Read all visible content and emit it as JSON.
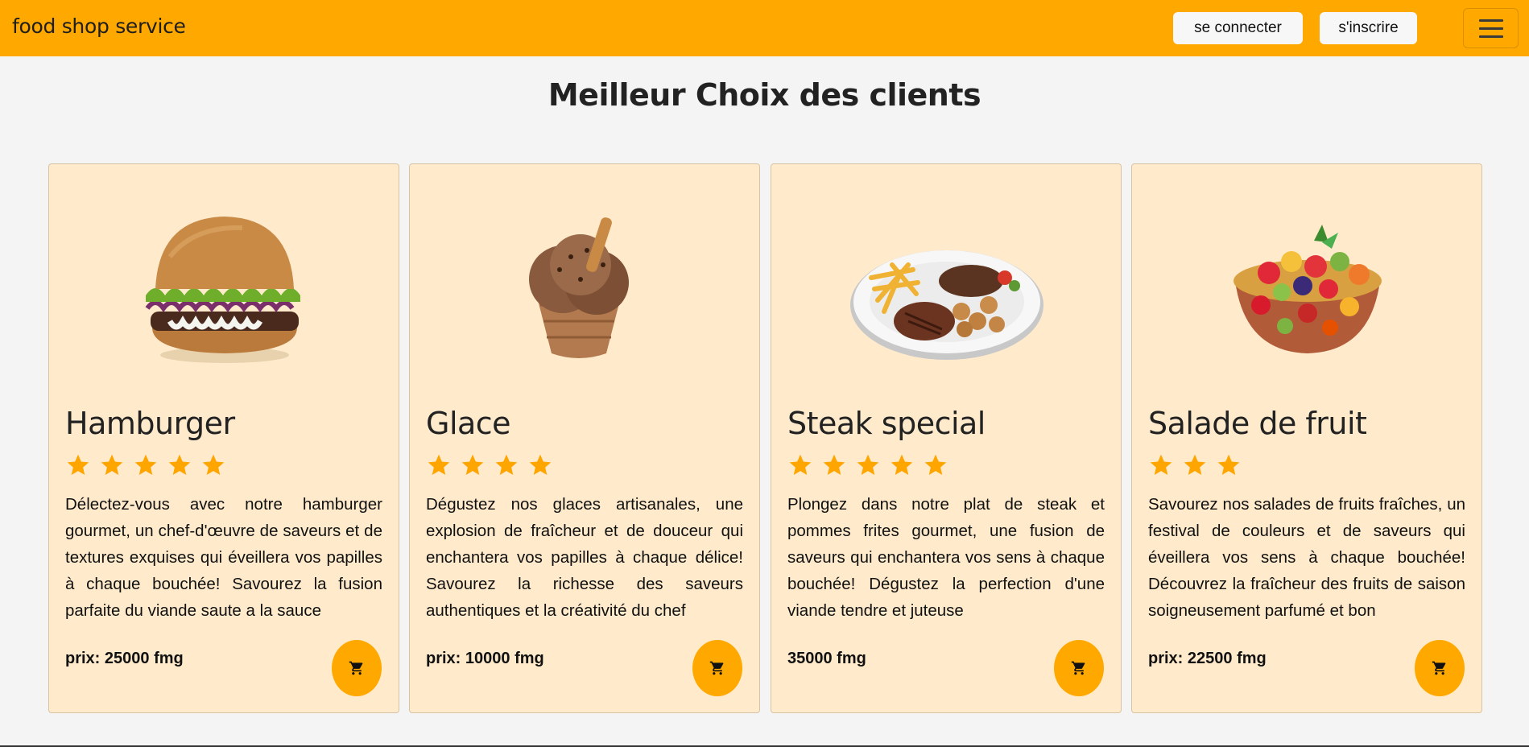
{
  "header": {
    "brand": "food shop service",
    "login_label": "se connecter",
    "signup_label": "s'inscrire",
    "menu_icon": "hamburger-menu-icon"
  },
  "section": {
    "title": "Meilleur Choix des clients"
  },
  "colors": {
    "accent": "#ffa800",
    "card_bg": "#ffebcc",
    "page_bg": "#f4f4f4",
    "star": "#ffa500"
  },
  "products": [
    {
      "name": "Hamburger",
      "image": "hamburger-image",
      "rating": 5,
      "description": "Délectez-vous avec notre hamburger gourmet, un chef-d'œuvre de saveurs et de textures exquises qui éveillera vos papilles à chaque bouchée! Savourez la fusion parfaite du viande saute a la sauce",
      "price": "prix: 25000 fmg",
      "cart_icon": "cart-icon"
    },
    {
      "name": "Glace",
      "image": "ice-cream-image",
      "rating": 4,
      "description": "Dégustez nos glaces artisanales, une explosion de fraîcheur et de douceur qui enchantera vos papilles à chaque délice! Savourez la richesse des saveurs authentiques et la créativité du chef",
      "price": "prix: 10000 fmg",
      "cart_icon": "cart-icon"
    },
    {
      "name": "Steak special",
      "image": "steak-plate-image",
      "rating": 5,
      "description": "Plongez dans notre plat de steak et pommes frites gourmet, une fusion de saveurs qui enchantera vos sens à chaque bouchée! Dégustez la perfection d'une viande tendre et juteuse",
      "price": "35000 fmg",
      "cart_icon": "cart-icon"
    },
    {
      "name": "Salade de fruit",
      "image": "fruit-salad-image",
      "rating": 3,
      "description": "Savourez nos salades de fruits fraîches, un festival de couleurs et de saveurs qui éveillera vos sens à chaque bouchée! Découvrez la fraîcheur des fruits de saison soigneusement parfumé et bon",
      "price": "prix: 22500 fmg",
      "cart_icon": "cart-icon"
    }
  ]
}
